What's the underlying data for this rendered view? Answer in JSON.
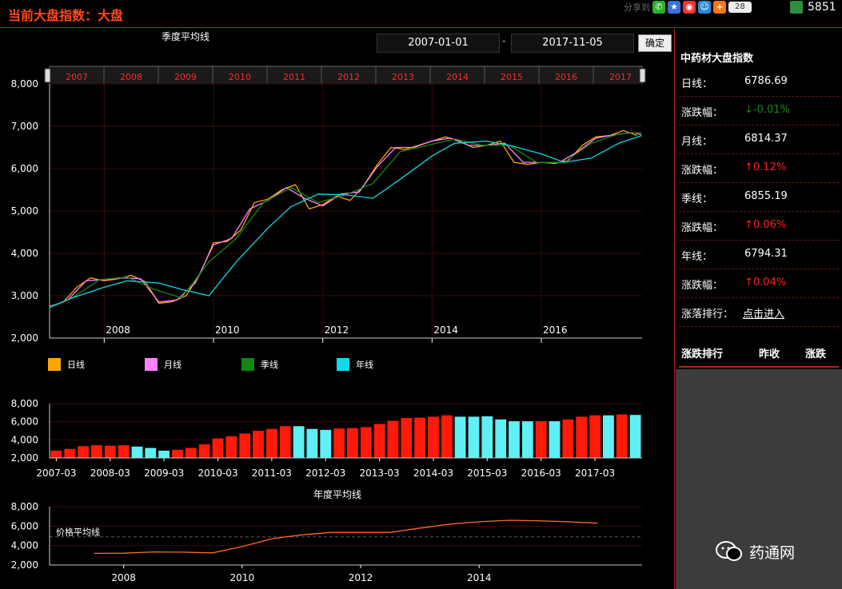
{
  "header": {
    "title": "当前大盘指数：大盘",
    "share_label": "分享到",
    "share_count": "28",
    "user_count": "5851"
  },
  "controls": {
    "start_date": "2007-01-01",
    "end_date": "2017-11-05",
    "separator": "-",
    "confirm_label": "确定"
  },
  "colors": {
    "daily": "#ffa500",
    "monthly": "#ff80ff",
    "quarterly": "#118811",
    "yearly": "#11d8e8",
    "bar_up": "#ff1a0a",
    "bar_down": "#5ef0f4",
    "accent": "#b3261e"
  },
  "chart_data": [
    {
      "type": "line",
      "title": "季度平均线",
      "navigator_labels": [
        "2007",
        "2008",
        "2009",
        "2010",
        "2011",
        "2012",
        "2013",
        "2014",
        "2015",
        "2016",
        "2017"
      ],
      "x_ticks": [
        "2008",
        "2010",
        "2012",
        "2014",
        "2016"
      ],
      "y_ticks": [
        "2,000",
        "3,000",
        "4,000",
        "5,000",
        "6,000",
        "7,000",
        "8,000"
      ],
      "ylim": [
        2000,
        8000
      ],
      "xlim": [
        "2007-01-01",
        "2017-11-05"
      ],
      "legend": [
        "日线",
        "月线",
        "季线",
        "年线"
      ],
      "series": [
        {
          "name": "日线",
          "color": "#ffa500",
          "points": [
            [
              "2007-01",
              2750
            ],
            [
              "2007-04",
              2850
            ],
            [
              "2007-07",
              3200
            ],
            [
              "2007-10",
              3420
            ],
            [
              "2008-01",
              3350
            ],
            [
              "2008-04",
              3400
            ],
            [
              "2008-07",
              3480
            ],
            [
              "2008-10",
              3330
            ],
            [
              "2009-01",
              2820
            ],
            [
              "2009-04",
              2860
            ],
            [
              "2009-07",
              3000
            ],
            [
              "2009-10",
              3500
            ],
            [
              "2010-01",
              4250
            ],
            [
              "2010-04",
              4280
            ],
            [
              "2010-07",
              4550
            ],
            [
              "2010-10",
              5200
            ],
            [
              "2011-01",
              5280
            ],
            [
              "2011-04",
              5500
            ],
            [
              "2011-07",
              5620
            ],
            [
              "2011-10",
              5050
            ],
            [
              "2012-01",
              5150
            ],
            [
              "2012-04",
              5350
            ],
            [
              "2012-07",
              5250
            ],
            [
              "2012-10",
              5600
            ],
            [
              "2013-01",
              6100
            ],
            [
              "2013-04",
              6500
            ],
            [
              "2013-07",
              6450
            ],
            [
              "2013-10",
              6550
            ],
            [
              "2014-01",
              6650
            ],
            [
              "2014-04",
              6750
            ],
            [
              "2014-07",
              6650
            ],
            [
              "2014-10",
              6500
            ],
            [
              "2015-01",
              6550
            ],
            [
              "2015-04",
              6650
            ],
            [
              "2015-07",
              6150
            ],
            [
              "2015-10",
              6100
            ],
            [
              "2016-01",
              6150
            ],
            [
              "2016-04",
              6120
            ],
            [
              "2016-07",
              6200
            ],
            [
              "2016-10",
              6550
            ],
            [
              "2017-01",
              6750
            ],
            [
              "2017-04",
              6780
            ],
            [
              "2017-07",
              6900
            ],
            [
              "2017-10",
              6780
            ]
          ]
        },
        {
          "name": "月线",
          "color": "#ff80ff",
          "points": [
            [
              "2007-01",
              2740
            ],
            [
              "2007-05",
              2900
            ],
            [
              "2007-09",
              3350
            ],
            [
              "2008-01",
              3380
            ],
            [
              "2008-05",
              3420
            ],
            [
              "2008-09",
              3400
            ],
            [
              "2009-01",
              2850
            ],
            [
              "2009-05",
              2900
            ],
            [
              "2009-09",
              3300
            ],
            [
              "2010-01",
              4200
            ],
            [
              "2010-05",
              4350
            ],
            [
              "2010-09",
              5050
            ],
            [
              "2011-01",
              5250
            ],
            [
              "2011-05",
              5550
            ],
            [
              "2011-09",
              5300
            ],
            [
              "2012-01",
              5120
            ],
            [
              "2012-05",
              5400
            ],
            [
              "2012-09",
              5450
            ],
            [
              "2013-01",
              6050
            ],
            [
              "2013-05",
              6500
            ],
            [
              "2013-09",
              6500
            ],
            [
              "2014-01",
              6650
            ],
            [
              "2014-05",
              6720
            ],
            [
              "2014-09",
              6550
            ],
            [
              "2015-01",
              6550
            ],
            [
              "2015-05",
              6600
            ],
            [
              "2015-09",
              6150
            ],
            [
              "2016-01",
              6150
            ],
            [
              "2016-05",
              6150
            ],
            [
              "2016-09",
              6400
            ],
            [
              "2017-01",
              6720
            ],
            [
              "2017-05",
              6800
            ],
            [
              "2017-09",
              6850
            ],
            [
              "2017-11",
              6800
            ]
          ]
        },
        {
          "name": "季线",
          "color": "#118811",
          "points": [
            [
              "2007-01",
              2730
            ],
            [
              "2007-06",
              2950
            ],
            [
              "2007-12",
              3380
            ],
            [
              "2008-06",
              3440
            ],
            [
              "2008-12",
              3150
            ],
            [
              "2009-06",
              2950
            ],
            [
              "2009-12",
              3800
            ],
            [
              "2010-06",
              4350
            ],
            [
              "2010-12",
              5200
            ],
            [
              "2011-06",
              5550
            ],
            [
              "2011-12",
              5200
            ],
            [
              "2012-06",
              5380
            ],
            [
              "2012-12",
              5650
            ],
            [
              "2013-06",
              6400
            ],
            [
              "2013-12",
              6550
            ],
            [
              "2014-06",
              6700
            ],
            [
              "2014-12",
              6550
            ],
            [
              "2015-06",
              6550
            ],
            [
              "2015-12",
              6150
            ],
            [
              "2016-06",
              6150
            ],
            [
              "2016-12",
              6600
            ],
            [
              "2017-06",
              6820
            ],
            [
              "2017-11",
              6850
            ]
          ]
        },
        {
          "name": "年线",
          "color": "#11d8e8",
          "points": [
            [
              "2007-01",
              2720
            ],
            [
              "2007-06",
              2950
            ],
            [
              "2008-01",
              3200
            ],
            [
              "2008-06",
              3350
            ],
            [
              "2009-01",
              3300
            ],
            [
              "2009-06",
              3150
            ],
            [
              "2009-12",
              3000
            ],
            [
              "2010-06",
              3800
            ],
            [
              "2011-01",
              4600
            ],
            [
              "2011-06",
              5100
            ],
            [
              "2011-12",
              5400
            ],
            [
              "2012-06",
              5380
            ],
            [
              "2012-12",
              5300
            ],
            [
              "2013-06",
              5750
            ],
            [
              "2014-01",
              6300
            ],
            [
              "2014-06",
              6600
            ],
            [
              "2015-01",
              6650
            ],
            [
              "2015-06",
              6550
            ],
            [
              "2016-01",
              6350
            ],
            [
              "2016-06",
              6150
            ],
            [
              "2016-12",
              6250
            ],
            [
              "2017-06",
              6600
            ],
            [
              "2017-11",
              6780
            ]
          ]
        }
      ]
    },
    {
      "type": "bar",
      "categories": [
        "2007-03",
        "2007-06",
        "2007-09",
        "2007-12",
        "2008-03",
        "2008-06",
        "2008-09",
        "2008-12",
        "2009-03",
        "2009-06",
        "2009-09",
        "2009-12",
        "2010-03",
        "2010-06",
        "2010-09",
        "2010-12",
        "2011-03",
        "2011-06",
        "2011-09",
        "2011-12",
        "2012-03",
        "2012-06",
        "2012-09",
        "2012-12",
        "2013-03",
        "2013-06",
        "2013-09",
        "2013-12",
        "2014-03",
        "2014-06",
        "2014-09",
        "2014-12",
        "2015-03",
        "2015-06",
        "2015-09",
        "2015-12",
        "2016-03",
        "2016-06",
        "2016-09",
        "2016-12",
        "2017-03",
        "2017-06",
        "2017-09",
        "2017-11"
      ],
      "values": [
        2800,
        3000,
        3300,
        3400,
        3350,
        3400,
        3250,
        3100,
        2800,
        2900,
        3100,
        3500,
        4150,
        4400,
        4700,
        5000,
        5200,
        5500,
        5500,
        5200,
        5100,
        5250,
        5300,
        5400,
        5750,
        6100,
        6400,
        6450,
        6550,
        6700,
        6550,
        6550,
        6600,
        6250,
        6050,
        6050,
        6050,
        6050,
        6250,
        6550,
        6700,
        6700,
        6800,
        6750
      ],
      "direction": [
        "up",
        "up",
        "up",
        "up",
        "up",
        "up",
        "down",
        "down",
        "down",
        "up",
        "up",
        "up",
        "up",
        "up",
        "up",
        "up",
        "up",
        "up",
        "down",
        "down",
        "down",
        "up",
        "up",
        "up",
        "up",
        "up",
        "up",
        "up",
        "up",
        "up",
        "down",
        "down",
        "down",
        "down",
        "down",
        "down",
        "up",
        "down",
        "up",
        "up",
        "up",
        "down",
        "up",
        "down"
      ],
      "x_ticks": [
        "2007-03",
        "2008-03",
        "2009-03",
        "2010-03",
        "2011-03",
        "2012-03",
        "2013-03",
        "2014-03",
        "2015-03",
        "2016-03",
        "2017-03"
      ],
      "y_ticks": [
        "2,000",
        "4,000",
        "6,000",
        "8,000"
      ],
      "ylim": [
        2000,
        8000
      ]
    },
    {
      "type": "line",
      "title": "年度平均线",
      "series_label": "价格平均线",
      "x_ticks": [
        "2008",
        "2010",
        "2012",
        "2014"
      ],
      "y_ticks": [
        "2,000",
        "4,000",
        "6,000",
        "8,000"
      ],
      "ylim": [
        2000,
        8000
      ],
      "reference_line": 4900,
      "series": [
        {
          "name": "价格平均线",
          "color": "#ff6a2a",
          "points": [
            [
              2007.5,
              3200
            ],
            [
              2008.0,
              3220
            ],
            [
              2008.5,
              3350
            ],
            [
              2009.0,
              3320
            ],
            [
              2009.5,
              3250
            ],
            [
              2010.0,
              3900
            ],
            [
              2010.5,
              4700
            ],
            [
              2011.0,
              5100
            ],
            [
              2011.5,
              5350
            ],
            [
              2012.0,
              5350
            ],
            [
              2012.5,
              5350
            ],
            [
              2013.0,
              5800
            ],
            [
              2013.5,
              6200
            ],
            [
              2014.0,
              6450
            ],
            [
              2014.5,
              6600
            ],
            [
              2015.0,
              6550
            ],
            [
              2015.5,
              6450
            ],
            [
              2016.0,
              6300
            ]
          ]
        }
      ]
    }
  ],
  "panel": {
    "title": "中药材大盘指数",
    "rows": [
      {
        "label": "日线：",
        "value": "6786.69",
        "color": "#ffffff"
      },
      {
        "label": "涨跌幅：",
        "value": "↓-0.01%",
        "color": "#1a8a1a"
      },
      {
        "label": "月线：",
        "value": "6814.37",
        "color": "#ffffff"
      },
      {
        "label": "涨跌幅：",
        "value": "↑0.12%",
        "color": "#ff2020"
      },
      {
        "label": "季线：",
        "value": "6855.19",
        "color": "#ffffff"
      },
      {
        "label": "涨跌幅：",
        "value": "↑0.06%",
        "color": "#ff2020"
      },
      {
        "label": "年线：",
        "value": "6794.31",
        "color": "#ffffff"
      },
      {
        "label": "涨跌幅：",
        "value": "↑0.04%",
        "color": "#ff2020"
      },
      {
        "label": "涨落排行：",
        "value": "点击进入",
        "color": "#ffffff"
      }
    ],
    "rank_headers": [
      "涨跌排行",
      "昨收",
      "涨跌"
    ]
  },
  "watermark": "药通网"
}
